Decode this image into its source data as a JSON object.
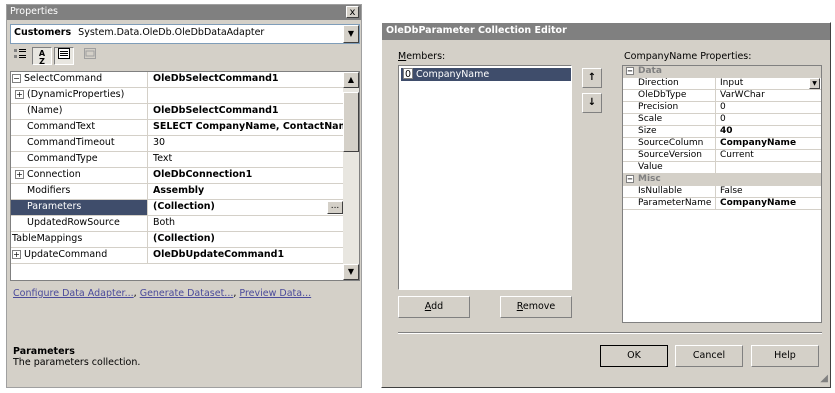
{
  "properties_panel": {
    "title": "Properties",
    "close": "x",
    "object_name": "Customers",
    "object_type": "System.Data.OleDb.OleDbDataAdapter",
    "rows": [
      {
        "name": "SelectCommand",
        "value": "OleDbSelectCommand1",
        "bold": true,
        "expander": "⊟",
        "indent": 0
      },
      {
        "name": "(DynamicProperties)",
        "value": "",
        "bold": false,
        "expander": "⊞",
        "indent": 1
      },
      {
        "name": "(Name)",
        "value": "OleDbSelectCommand1",
        "bold": true,
        "expander": "",
        "indent": 1
      },
      {
        "name": "CommandText",
        "value": "SELECT CompanyName, ContactName",
        "bold": true,
        "expander": "",
        "indent": 1
      },
      {
        "name": "CommandTimeout",
        "value": "30",
        "bold": false,
        "expander": "",
        "indent": 1
      },
      {
        "name": "CommandType",
        "value": "Text",
        "bold": false,
        "expander": "",
        "indent": 1
      },
      {
        "name": "Connection",
        "value": "OleDbConnection1",
        "bold": true,
        "expander": "⊞",
        "indent": 1
      },
      {
        "name": "Modifiers",
        "value": "Assembly",
        "bold": true,
        "expander": "",
        "indent": 1
      },
      {
        "name": "Parameters",
        "value": "(Collection)",
        "bold": true,
        "expander": "",
        "indent": 1,
        "selected": true,
        "ellipsis": "..."
      },
      {
        "name": "UpdatedRowSource",
        "value": "Both",
        "bold": false,
        "expander": "",
        "indent": 1
      },
      {
        "name": "TableMappings",
        "value": "(Collection)",
        "bold": true,
        "expander": "",
        "indent": 0
      },
      {
        "name": "UpdateCommand",
        "value": "OleDbUpdateCommand1",
        "bold": true,
        "expander": "⊞",
        "indent": 0
      }
    ],
    "links": [
      "Configure Data Adapter...",
      "Generate Dataset...",
      "Preview Data..."
    ],
    "description_title": "Parameters",
    "description_text": "The parameters collection."
  },
  "dialog": {
    "title": "OleDbParameter Collection Editor",
    "members_label": "Members:",
    "members": [
      {
        "index": "0",
        "name": "CompanyName"
      }
    ],
    "move_up": "↑",
    "move_down": "↓",
    "add": "Add",
    "remove": "Remove",
    "properties_label": "CompanyName Properties:",
    "categories": [
      {
        "name": "Data",
        "rows": [
          {
            "name": "Direction",
            "value": "Input",
            "bold": false,
            "dropdown": true
          },
          {
            "name": "OleDbType",
            "value": "VarWChar",
            "bold": false
          },
          {
            "name": "Precision",
            "value": "0",
            "bold": false
          },
          {
            "name": "Scale",
            "value": "0",
            "bold": false
          },
          {
            "name": "Size",
            "value": "40",
            "bold": true
          },
          {
            "name": "SourceColumn",
            "value": "CompanyName",
            "bold": true
          },
          {
            "name": "SourceVersion",
            "value": "Current",
            "bold": false
          },
          {
            "name": "Value",
            "value": "",
            "bold": false
          }
        ]
      },
      {
        "name": "Misc",
        "rows": [
          {
            "name": "IsNullable",
            "value": "False",
            "bold": false
          },
          {
            "name": "ParameterName",
            "value": "CompanyName",
            "bold": true
          }
        ]
      }
    ],
    "ok": "OK",
    "cancel": "Cancel",
    "help": "Help"
  }
}
